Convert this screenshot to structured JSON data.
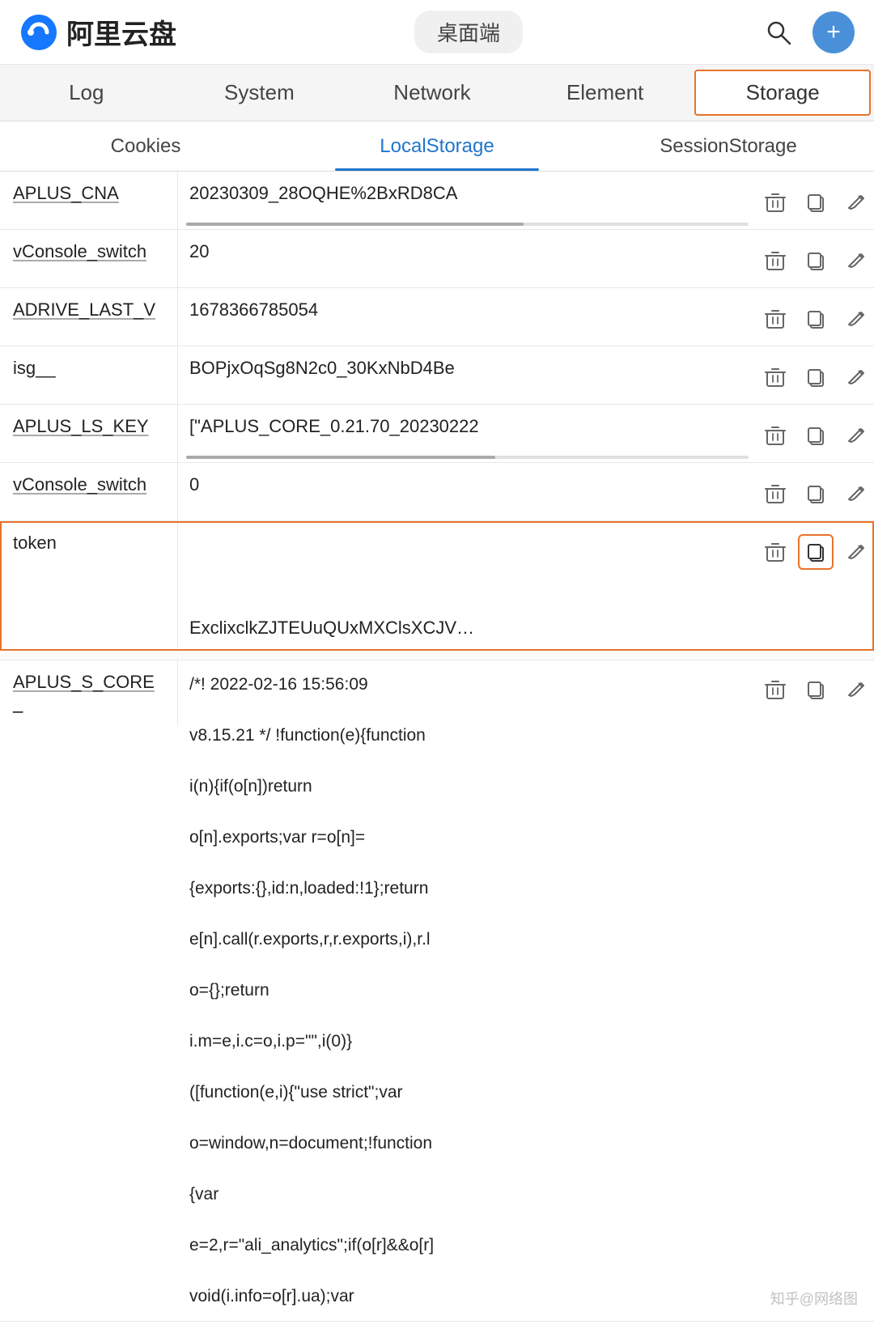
{
  "header": {
    "logo_alt": "Aliyun logo",
    "app_name": "阿里云盘",
    "center_label": "桌面端",
    "search_icon": "🔍",
    "add_icon": "+"
  },
  "devtools": {
    "tabs": [
      {
        "label": "Log",
        "active": false
      },
      {
        "label": "System",
        "active": false
      },
      {
        "label": "Network",
        "active": false
      },
      {
        "label": "Element",
        "active": false
      },
      {
        "label": "Storage",
        "active": true
      }
    ]
  },
  "storage": {
    "subtabs": [
      {
        "label": "Cookies",
        "active": false
      },
      {
        "label": "LocalStorage",
        "active": true
      },
      {
        "label": "SessionStorage",
        "active": false
      }
    ],
    "rows": [
      {
        "key": "APLUS_CNA",
        "value": "20230309_28OQHE%2BxRD8CA",
        "has_scrollbar": true,
        "highlighted": false
      },
      {
        "key": "vConsole_switch",
        "value": "20",
        "has_scrollbar": false,
        "highlighted": false
      },
      {
        "key": "ADRIVE_LAST_V",
        "value": "1678366785054",
        "has_scrollbar": false,
        "highlighted": false
      },
      {
        "key": "isg__",
        "value": "BOPjxOqSg8N2c0_30KxNbD4Be",
        "has_scrollbar": false,
        "highlighted": false
      },
      {
        "key": "APLUS_LS_KEY",
        "value": "[\"APLUS_CORE_0.21.70_20230222",
        "has_scrollbar": true,
        "highlighted": false
      },
      {
        "key": "vConsole_switch",
        "value": "0",
        "has_scrollbar": false,
        "highlighted": false
      }
    ],
    "token_row": {
      "key": "token",
      "value": "ExclixclkZJTEUuQUxMXClsXCJV…",
      "highlighted": true
    },
    "aplus_core_row": {
      "key": "APLUS_S_CORE_",
      "value": "/*! 2022-02-16 15:56:09\nv8.15.21 */ !function(e){function\ni(n){if(o[n])return\no[n].exports;var r=o[n]=\n{exports:{},id:n,loaded:!1};return\ne[n].call(r.exports,r,r.exports,i),r.l\no={};return\ni.m=e,i.c=o,i.p=\"\",i(0)}\n([function(e,i){\"use strict\";var\no=window,n=document;!function\n{var\ne=2,r=\"ali_analytics\";if(o[r]&&o[r]\nvoid(i.info=o[r].ua);var",
      "highlighted": false
    }
  },
  "icons": {
    "delete": "🗑",
    "copy": "⧉",
    "edit": "✎",
    "search": "⌕",
    "add": "+"
  },
  "watermark": "知乎@网络图"
}
